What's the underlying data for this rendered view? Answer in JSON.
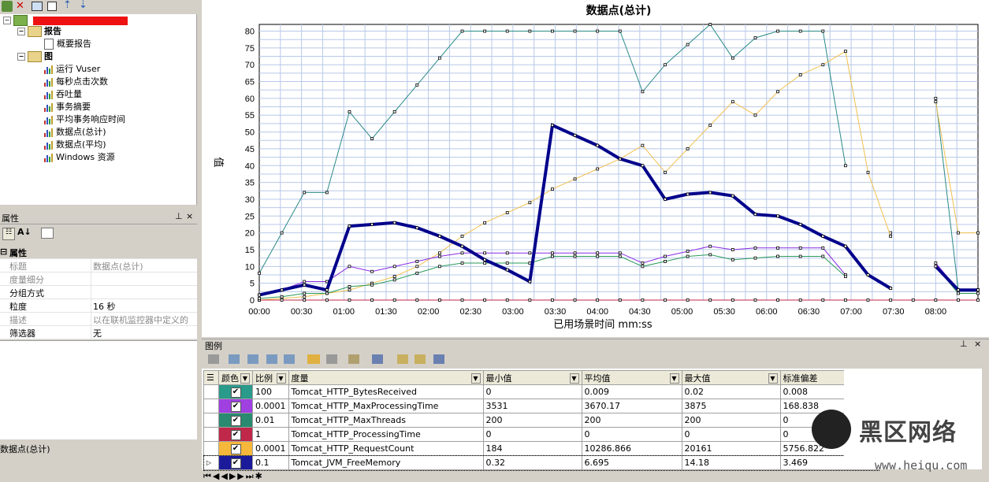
{
  "tree": {
    "root_label_redacted": true,
    "report_folder": "报告",
    "report_items": [
      "概要报告"
    ],
    "graph_folder": "图",
    "graph_items": [
      "运行 Vuser",
      "每秒点击次数",
      "吞吐量",
      "事务摘要",
      "平均事务响应时间",
      "数据点(总计)",
      "数据点(平均)",
      "Windows 资源"
    ]
  },
  "properties": {
    "pane_title": "属性",
    "pin": "ᵽ",
    "close": "×",
    "group": "属性",
    "rows": [
      {
        "key": "标题",
        "value": "数据点(总计)",
        "disabled": true
      },
      {
        "key": "度量细分",
        "value": "",
        "disabled": true
      },
      {
        "key": "分组方式",
        "value": "",
        "disabled": false
      },
      {
        "key": "粒度",
        "value": "16 秒",
        "disabled": false
      },
      {
        "key": "描述",
        "value": "以在联机监控器中定义的",
        "disabled": true
      },
      {
        "key": "筛选器",
        "value": "无",
        "disabled": false
      }
    ]
  },
  "status_text": "数据点(总计)",
  "chart_data": {
    "type": "line",
    "title": "数据点(总计)",
    "xlabel": "已用场景时间 mm:ss",
    "ylabel": "值",
    "ylim": [
      0,
      82
    ],
    "xlim": [
      0,
      510
    ],
    "x_ticks": [
      "00:00",
      "00:30",
      "01:00",
      "01:30",
      "02:00",
      "02:30",
      "03:00",
      "03:30",
      "04:00",
      "04:30",
      "05:00",
      "05:30",
      "06:00",
      "06:30",
      "07:00",
      "07:30",
      "08:00"
    ],
    "y_ticks": [
      0,
      5,
      10,
      15,
      20,
      25,
      30,
      35,
      40,
      45,
      50,
      55,
      60,
      65,
      70,
      75,
      80
    ],
    "x": [
      0,
      16,
      32,
      48,
      64,
      80,
      96,
      112,
      128,
      144,
      160,
      176,
      192,
      208,
      224,
      240,
      256,
      272,
      288,
      304,
      320,
      336,
      352,
      368,
      384,
      400,
      416,
      432,
      448,
      464,
      480,
      496,
      510
    ],
    "series": [
      {
        "name": "Tomcat_HTTP_MaxThreads",
        "color": "#2a8a87",
        "width": 1,
        "values": [
          8,
          20,
          32,
          32,
          56,
          48,
          56,
          64,
          72,
          80,
          80,
          80,
          80,
          80,
          80,
          80,
          80,
          62,
          70,
          76,
          82,
          72,
          78,
          80,
          80,
          80,
          40,
          null,
          20,
          null,
          60,
          3,
          3
        ]
      },
      {
        "name": "Tomcat_HTTP_RequestCount",
        "color": "#f2c14e",
        "width": 1,
        "values": [
          0,
          0.5,
          1,
          2,
          3,
          5,
          7,
          10,
          14,
          19,
          23,
          26,
          29,
          33,
          36,
          39,
          42,
          46,
          38,
          45,
          52,
          59,
          55,
          62,
          67,
          70,
          74,
          38,
          19,
          null,
          59,
          20,
          20
        ]
      },
      {
        "name": "Tomcat_HTTP_MaxProcessingTime",
        "color": "#8a2be2",
        "width": 1,
        "values": [
          1.5,
          3,
          5.5,
          5.5,
          10,
          8.5,
          10,
          11.5,
          13,
          14,
          14,
          14,
          14,
          14,
          14,
          14,
          14,
          11,
          13,
          14.5,
          16,
          15,
          15.5,
          15.5,
          15.5,
          15.5,
          7.5,
          null,
          3.5,
          null,
          11,
          3,
          3
        ]
      },
      {
        "name": "Tomcat_HTTP_ProcessingTime",
        "color": "#c0284a",
        "width": 1,
        "values": [
          0,
          0,
          0,
          0,
          0,
          0,
          0,
          0,
          0,
          0,
          0,
          0,
          0,
          0,
          0,
          0,
          0,
          0,
          0,
          0,
          0,
          0,
          0,
          0,
          0,
          0,
          0,
          0,
          0,
          0,
          0,
          0,
          0
        ]
      },
      {
        "name": "Tomcat_HTTP_BytesReceived",
        "color": "#2a9a5a",
        "width": 1,
        "values": [
          0.5,
          1,
          2,
          2,
          4,
          4.5,
          6,
          8,
          10,
          11,
          11,
          11,
          11,
          13,
          13,
          13,
          13,
          10,
          11.5,
          13,
          13.5,
          12,
          12.5,
          13,
          13,
          13,
          7,
          null,
          3.5,
          null,
          10,
          2,
          2
        ]
      },
      {
        "name": "Tomcat_JVM_FreeMemory",
        "color": "#00008b",
        "width": 4,
        "values": [
          1.5,
          3,
          4.5,
          3,
          22,
          22.5,
          23,
          21.5,
          19,
          16,
          12,
          9,
          5.5,
          52,
          49,
          46,
          42,
          40,
          30,
          31.5,
          32,
          31,
          25.5,
          25,
          22.5,
          19,
          16,
          7.5,
          3.5,
          null,
          10,
          3,
          3
        ]
      }
    ]
  },
  "legend": {
    "title": "图例",
    "columns": [
      "颜色",
      "比例",
      "度量",
      "最小值",
      "平均值",
      "最大值",
      "标准偏差"
    ],
    "rows": [
      {
        "color": "#2a9a8a",
        "scale": "100",
        "measure": "Tomcat_HTTP_BytesReceived",
        "min": "0",
        "avg": "0.009",
        "max": "0.02",
        "std": "0.008"
      },
      {
        "color": "#a040e0",
        "scale": "0.0001",
        "measure": "Tomcat_HTTP_MaxProcessingTime",
        "min": "3531",
        "avg": "3670.17",
        "max": "3875",
        "std": "168.838"
      },
      {
        "color": "#2a8a70",
        "scale": "0.01",
        "measure": "Tomcat_HTTP_MaxThreads",
        "min": "200",
        "avg": "200",
        "max": "200",
        "std": "0"
      },
      {
        "color": "#c0284a",
        "scale": "1",
        "measure": "Tomcat_HTTP_ProcessingTime",
        "min": "0",
        "avg": "0",
        "max": "0",
        "std": "0"
      },
      {
        "color": "#f5b83a",
        "scale": "0.0001",
        "measure": "Tomcat_HTTP_RequestCount",
        "min": "184",
        "avg": "10286.866",
        "max": "20161",
        "std": "5756.822"
      },
      {
        "color": "#1a1a9a",
        "scale": "0.1",
        "measure": "Tomcat_JVM_FreeMemory",
        "min": "0.32",
        "avg": "6.695",
        "max": "14.18",
        "std": "3.469"
      }
    ]
  },
  "watermark": {
    "text": "黑区网络",
    "url": "www.heiqu.com"
  }
}
